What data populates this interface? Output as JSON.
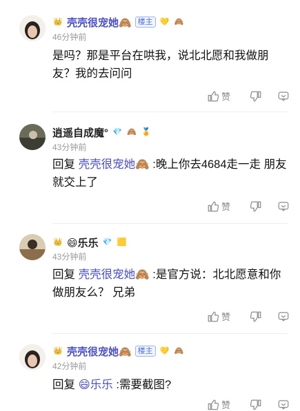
{
  "comments": [
    {
      "username": "壳壳很宠她🙈",
      "badges": [
        "crown-badge",
        "owner-badge",
        "diamond-badge",
        "emoji-badge"
      ],
      "owner_label": "楼主",
      "timestamp": "46分钟前",
      "text": "是吗？那是平台在哄我，说北北愿和我做朋友？我的去问问",
      "like_label": "赞"
    },
    {
      "username": "逍遥自成魔°",
      "timestamp": "43分钟前",
      "reply_prefix": "回复",
      "mention": "壳壳很宠她🙈",
      "text": ":晚上你去4684走一走 朋友就交上了",
      "like_label": "赞"
    },
    {
      "username": "😄乐乐",
      "timestamp": "43分钟前",
      "reply_prefix": "回复",
      "mention": "壳壳很宠她🙈",
      "text": ":是官方说：北北愿意和你做朋友么？ 兄弟",
      "like_label": "赞"
    },
    {
      "username": "壳壳很宠她🙈",
      "owner_label": "楼主",
      "timestamp": "42分钟前",
      "reply_prefix": "回复",
      "mention": "😄乐乐",
      "text": ":需要截图?",
      "like_label": "赞"
    }
  ],
  "colors": {
    "mention": "#4a4ec8",
    "owner_name": "#4a4ec8",
    "meta": "#9a9a9a"
  }
}
